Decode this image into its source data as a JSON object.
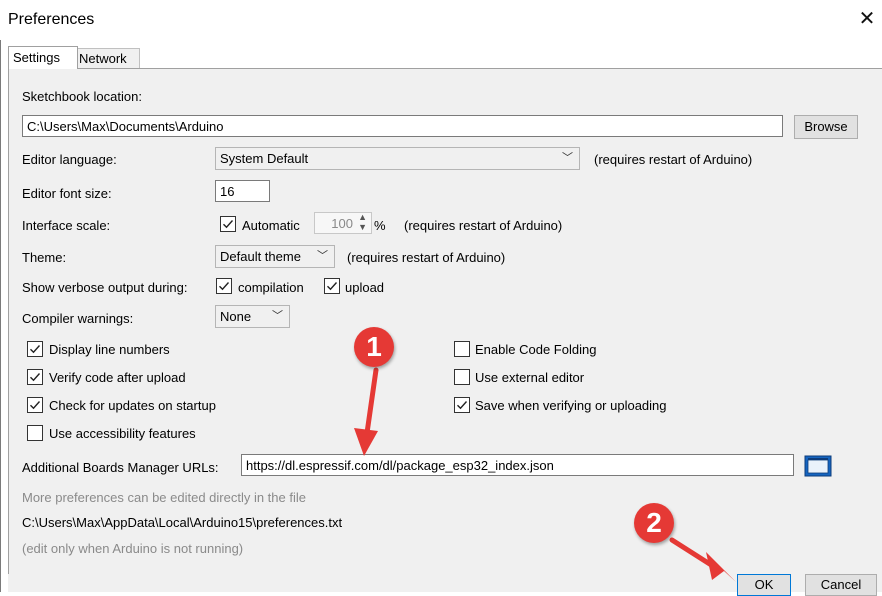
{
  "window": {
    "title": "Preferences"
  },
  "tabs": [
    {
      "label": "Settings"
    },
    {
      "label": "Network"
    }
  ],
  "sketchbook": {
    "label": "Sketchbook location:",
    "value": "C:\\Users\\Max\\Documents\\Arduino",
    "browse_label": "Browse"
  },
  "editor_language": {
    "label": "Editor language:",
    "value": "System Default",
    "note": "(requires restart of Arduino)"
  },
  "editor_font_size": {
    "label": "Editor font size:",
    "value": "16"
  },
  "interface_scale": {
    "label": "Interface scale:",
    "automatic_label": "Automatic",
    "automatic_checked": true,
    "value": "100",
    "unit": "%",
    "note": "(requires restart of Arduino)"
  },
  "theme": {
    "label": "Theme:",
    "value": "Default theme",
    "note": "(requires restart of Arduino)"
  },
  "verbose": {
    "label": "Show verbose output during:",
    "compilation_label": "compilation",
    "compilation_checked": true,
    "upload_label": "upload",
    "upload_checked": true
  },
  "compiler_warnings": {
    "label": "Compiler warnings:",
    "value": "None"
  },
  "options_left": [
    {
      "label": "Display line numbers",
      "checked": true
    },
    {
      "label": "Verify code after upload",
      "checked": true
    },
    {
      "label": "Check for updates on startup",
      "checked": true
    },
    {
      "label": "Use accessibility features",
      "checked": false
    }
  ],
  "options_right": [
    {
      "label": "Enable Code Folding",
      "checked": false
    },
    {
      "label": "Use external editor",
      "checked": false
    },
    {
      "label": "Save when verifying or uploading",
      "checked": true
    }
  ],
  "boards_manager": {
    "label": "Additional Boards Manager URLs:",
    "value": "https://dl.espressif.com/dl/package_esp32_index.json"
  },
  "more_prefs": {
    "text": "More preferences can be edited directly in the file",
    "path": "C:\\Users\\Max\\AppData\\Local\\Arduino15\\preferences.txt",
    "note": "(edit only when Arduino is not running)"
  },
  "buttons": {
    "ok": "OK",
    "cancel": "Cancel"
  },
  "annotations": {
    "badge1": "1",
    "badge2": "2",
    "color": "#e53935"
  }
}
